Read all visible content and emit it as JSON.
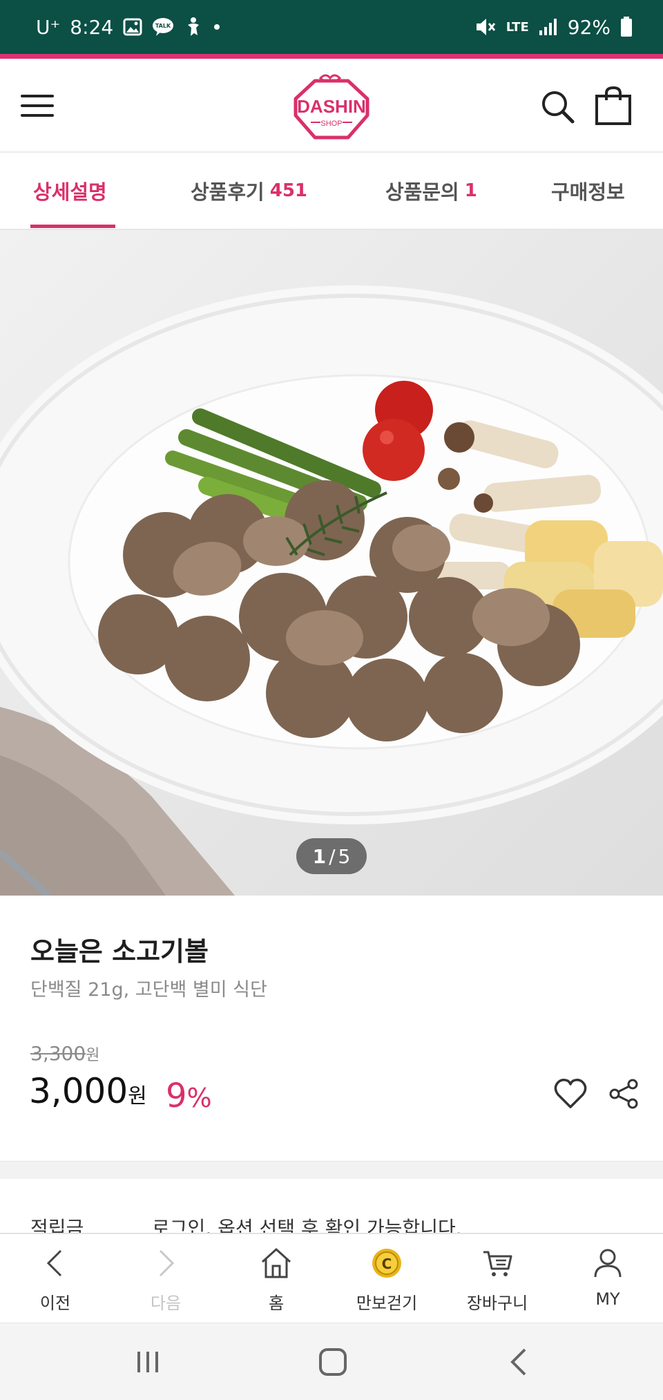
{
  "status_bar": {
    "carrier": "U⁺",
    "time": "8:24",
    "network": "LTE",
    "battery": "92%",
    "icons": [
      "image-icon",
      "talk-icon",
      "accessibility-icon",
      "dot-icon",
      "mute-icon",
      "lte-icon",
      "signal-icon",
      "battery-icon"
    ]
  },
  "header": {
    "logo_text": "DASHIN",
    "logo_sub": "SHOP",
    "brand_color": "#d9306b",
    "icons": [
      "menu-icon",
      "search-icon",
      "shopping-bag-icon"
    ]
  },
  "tabs": [
    {
      "label": "상세설명",
      "count": "",
      "active": true
    },
    {
      "label": "상품후기",
      "count": "451",
      "active": false
    },
    {
      "label": "상품문의",
      "count": "1",
      "active": false
    },
    {
      "label": "구매정보",
      "count": "",
      "active": false
    }
  ],
  "gallery": {
    "current": "1",
    "separator": "/",
    "total": "5"
  },
  "product": {
    "title": "오늘은 소고기볼",
    "subtitle": "단백질 21g, 고단백 별미 식단",
    "original_price": "3,300",
    "original_unit": "원",
    "price": "3,000",
    "price_unit": "원",
    "discount_value": "9",
    "discount_unit": "%",
    "actions": [
      "heart-icon",
      "share-icon"
    ]
  },
  "info": {
    "label": "적립금",
    "value": "로그인, 옵션 선택 후 확인 가능합니다."
  },
  "bottom_nav": [
    {
      "label": "이전",
      "icon": "chevron-left-icon",
      "enabled": true
    },
    {
      "label": "다음",
      "icon": "chevron-right-icon",
      "enabled": false
    },
    {
      "label": "홈",
      "icon": "home-icon",
      "enabled": true
    },
    {
      "label": "만보걷기",
      "icon": "coin-icon",
      "enabled": true
    },
    {
      "label": "장바구니",
      "icon": "cart-icon",
      "enabled": true
    },
    {
      "label": "MY",
      "icon": "user-icon",
      "enabled": true
    }
  ],
  "system_nav": [
    "recent-apps-icon",
    "home-button-icon",
    "back-icon"
  ]
}
